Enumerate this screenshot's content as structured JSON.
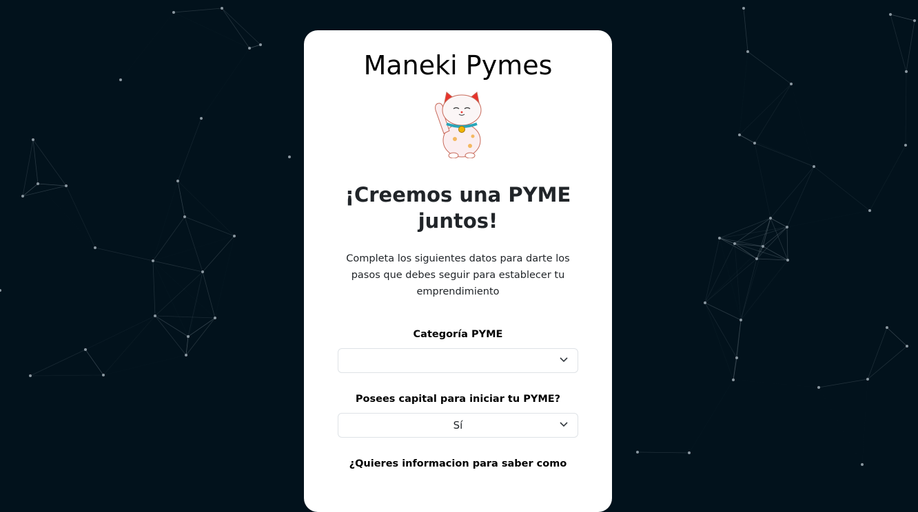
{
  "app": {
    "title": "Maneki Pymes"
  },
  "hero": {
    "headline": "¡Creemos una PYME juntos!",
    "description": "Completa los siguientes datos para darte los pasos que debes seguir para establecer tu emprendimiento",
    "image": "maneki-neko-cat"
  },
  "form": {
    "category": {
      "label": "Categoría PYME",
      "value": ""
    },
    "capital": {
      "label": "Posees capital para iniciar tu PYME?",
      "value": "Sí"
    },
    "info": {
      "label": "¿Quieres informacion para saber como"
    }
  },
  "colors": {
    "background": "#02121c",
    "card": "#ffffff",
    "network": "#8a97a0"
  }
}
